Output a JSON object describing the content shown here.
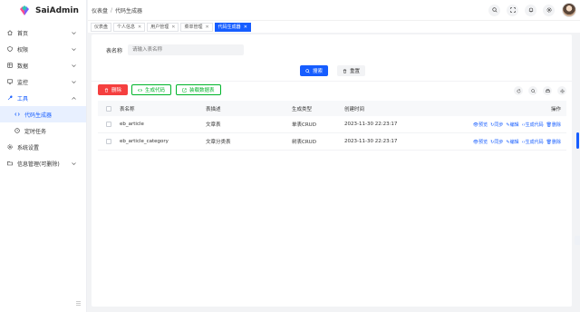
{
  "brand": {
    "name": "SaiAdmin"
  },
  "sidebar": {
    "items": [
      {
        "label": "首页",
        "icon": "home-icon",
        "expandable": true
      },
      {
        "label": "权限",
        "icon": "shield-icon",
        "expandable": true
      },
      {
        "label": "数据",
        "icon": "data-icon",
        "expandable": true
      },
      {
        "label": "监控",
        "icon": "monitor-icon",
        "expandable": true
      },
      {
        "label": "工具",
        "icon": "tool-icon",
        "expandable": true,
        "open": true
      },
      {
        "label": "代码生成器",
        "icon": "code-icon",
        "sub": true,
        "active": true
      },
      {
        "label": "定时任务",
        "icon": "clock-icon",
        "sub": true
      },
      {
        "label": "系统设置",
        "icon": "gear-icon"
      },
      {
        "label": "信息管理(可删除)",
        "icon": "folder-icon",
        "expandable": true
      }
    ]
  },
  "header": {
    "breadcrumb": [
      "仪表盘",
      "代码生成器"
    ]
  },
  "tabs": [
    {
      "label": "仪表盘",
      "closable": false,
      "active": false
    },
    {
      "label": "个人信息",
      "closable": true,
      "active": false
    },
    {
      "label": "用户管理",
      "closable": true,
      "active": false
    },
    {
      "label": "菜单管理",
      "closable": true,
      "active": false
    },
    {
      "label": "代码生成器",
      "closable": true,
      "active": true
    }
  ],
  "search": {
    "label": "表名称",
    "placeholder": "请输入表名称",
    "search_button": "搜索",
    "reset_button": "重置"
  },
  "toolbar": {
    "delete": "删除",
    "generate": "生成代码",
    "load": "装载数据表"
  },
  "table": {
    "columns": [
      "表名称",
      "表描述",
      "生成类型",
      "创建时间",
      "操作"
    ],
    "rows": [
      {
        "name": "eb_article",
        "desc": "文章表",
        "type": "单表CRUD",
        "time": "2023-11-30 22:23:17"
      },
      {
        "name": "eb_article_category",
        "desc": "文章分类表",
        "type": "树表CRUD",
        "time": "2023-11-30 22:23:17"
      }
    ],
    "ops": [
      "预览",
      "同步",
      "编辑",
      "生成代码",
      "删除"
    ]
  },
  "colors": {
    "primary": "#165dff",
    "danger": "#f53f3f",
    "success": "#00b42a"
  }
}
